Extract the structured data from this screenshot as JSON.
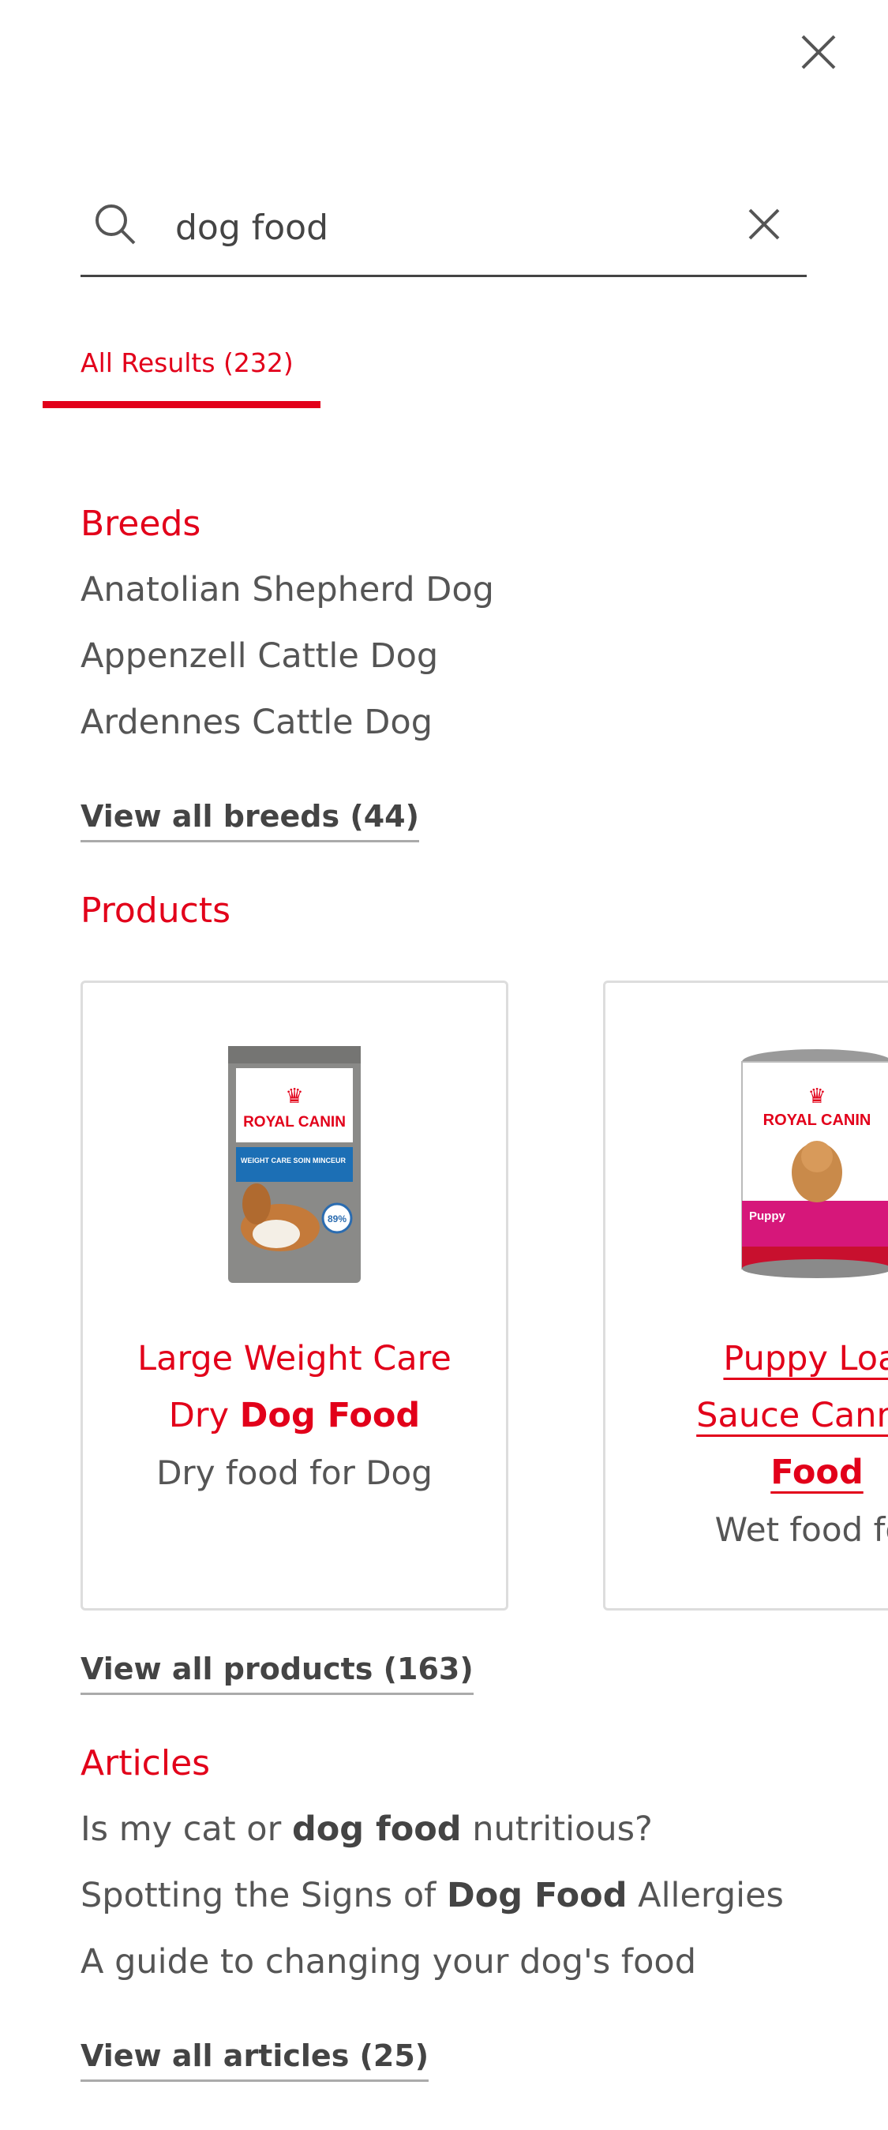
{
  "search": {
    "query": "dog food"
  },
  "tabs": [
    {
      "label": "All Results (232)"
    }
  ],
  "breeds": {
    "title": "Breeds",
    "items": [
      "Anatolian Shepherd Dog",
      "Appenzell Cattle Dog",
      "Ardennes Cattle Dog"
    ],
    "view_all": "View all breeds (44)"
  },
  "products": {
    "title": "Products",
    "items": [
      {
        "name_part1": "Large Weight Care",
        "name_part2": "Dry ",
        "name_bold": "Dog Food",
        "subtitle": "Dry food for Dog",
        "brand": "ROYAL CANIN",
        "label": "WEIGHT CARE SOIN MINCEUR",
        "badge": "89%"
      },
      {
        "name_part1": "Puppy Loaf",
        "name_part2": "Sauce Cannec",
        "name_bold": "Food",
        "subtitle": "Wet food for",
        "brand": "ROYAL CANIN",
        "label": "Puppy"
      }
    ],
    "view_all": "View all products (163)"
  },
  "articles": {
    "title": "Articles",
    "items": [
      {
        "pre": "Is my cat or ",
        "bold": "dog food",
        "post": " nutritious?"
      },
      {
        "pre": "Spotting the Signs of ",
        "bold": "Dog Food",
        "post": " Allergies"
      },
      {
        "pre": "A guide to changing your dog's food",
        "bold": "",
        "post": ""
      }
    ],
    "view_all": "View all articles (25)"
  },
  "colors": {
    "accent": "#e2001a",
    "text": "#444444",
    "border": "#dddddd"
  }
}
